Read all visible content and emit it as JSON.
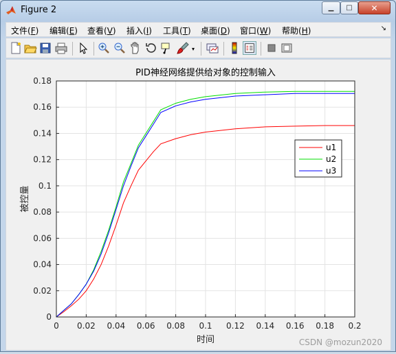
{
  "window": {
    "title": "Figure 2",
    "minimize_glyph": "▁",
    "maximize_glyph": "□",
    "close_glyph": "✕"
  },
  "menu": {
    "items": [
      {
        "label": "文件",
        "key": "F"
      },
      {
        "label": "编辑",
        "key": "E"
      },
      {
        "label": "查看",
        "key": "V"
      },
      {
        "label": "插入",
        "key": "I"
      },
      {
        "label": "工具",
        "key": "T"
      },
      {
        "label": "桌面",
        "key": "D"
      },
      {
        "label": "窗口",
        "key": "W"
      },
      {
        "label": "帮助",
        "key": "H"
      }
    ],
    "overflow_glyph": "↘"
  },
  "toolbar": {
    "icons": [
      "new-figure-icon",
      "open-file-icon",
      "save-icon",
      "print-icon",
      "pointer-icon",
      "zoom-in-icon",
      "zoom-out-icon",
      "pan-icon",
      "rotate-3d-icon",
      "data-cursor-icon",
      "brush-icon",
      "brush-dropdown-icon",
      "link-plot-icon",
      "colorbar-icon",
      "legend-icon",
      "hide-plot-tools-icon",
      "show-plot-tools-icon"
    ]
  },
  "chart_data": {
    "type": "line",
    "title": "PID神经网络提供给对象的控制输入",
    "xlabel": "时间",
    "ylabel": "被控量",
    "xlim": [
      0,
      0.2
    ],
    "ylim": [
      0,
      0.18
    ],
    "xticks": [
      "0",
      "0.02",
      "0.04",
      "0.06",
      "0.08",
      "0.1",
      "0.12",
      "0.14",
      "0.16",
      "0.18",
      "0.2"
    ],
    "yticks": [
      "0",
      "0.02",
      "0.04",
      "0.06",
      "0.08",
      "0.1",
      "0.12",
      "0.14",
      "0.16",
      "0.18"
    ],
    "grid": true,
    "legend_position": "right",
    "series": [
      {
        "name": "u1",
        "color": "#ff0000",
        "x": [
          0,
          0.005,
          0.01,
          0.015,
          0.02,
          0.025,
          0.03,
          0.035,
          0.04,
          0.045,
          0.05,
          0.055,
          0.06,
          0.065,
          0.07,
          0.08,
          0.09,
          0.1,
          0.12,
          0.14,
          0.16,
          0.18,
          0.2
        ],
        "y": [
          0,
          0.004,
          0.0085,
          0.0135,
          0.02,
          0.029,
          0.04,
          0.054,
          0.07,
          0.087,
          0.1,
          0.112,
          0.119,
          0.126,
          0.132,
          0.136,
          0.139,
          0.141,
          0.1435,
          0.145,
          0.1455,
          0.146,
          0.146
        ]
      },
      {
        "name": "u2",
        "color": "#00dd00",
        "x": [
          0,
          0.005,
          0.01,
          0.015,
          0.02,
          0.025,
          0.03,
          0.035,
          0.04,
          0.045,
          0.05,
          0.055,
          0.06,
          0.065,
          0.07,
          0.08,
          0.09,
          0.1,
          0.12,
          0.14,
          0.16,
          0.18,
          0.2
        ],
        "y": [
          0,
          0.005,
          0.01,
          0.017,
          0.025,
          0.036,
          0.05,
          0.066,
          0.084,
          0.103,
          0.117,
          0.131,
          0.14,
          0.149,
          0.158,
          0.163,
          0.166,
          0.168,
          0.1705,
          0.1715,
          0.172,
          0.172,
          0.172
        ]
      },
      {
        "name": "u3",
        "color": "#0000ff",
        "x": [
          0,
          0.005,
          0.01,
          0.015,
          0.02,
          0.025,
          0.03,
          0.035,
          0.04,
          0.045,
          0.05,
          0.055,
          0.06,
          0.065,
          0.07,
          0.08,
          0.09,
          0.1,
          0.12,
          0.14,
          0.16,
          0.18,
          0.2
        ],
        "y": [
          0,
          0.005,
          0.01,
          0.017,
          0.025,
          0.035,
          0.048,
          0.064,
          0.082,
          0.1,
          0.115,
          0.129,
          0.138,
          0.147,
          0.156,
          0.161,
          0.164,
          0.166,
          0.1685,
          0.1695,
          0.1705,
          0.1705,
          0.1705
        ]
      }
    ]
  },
  "watermark": "CSDN @mozun2020"
}
